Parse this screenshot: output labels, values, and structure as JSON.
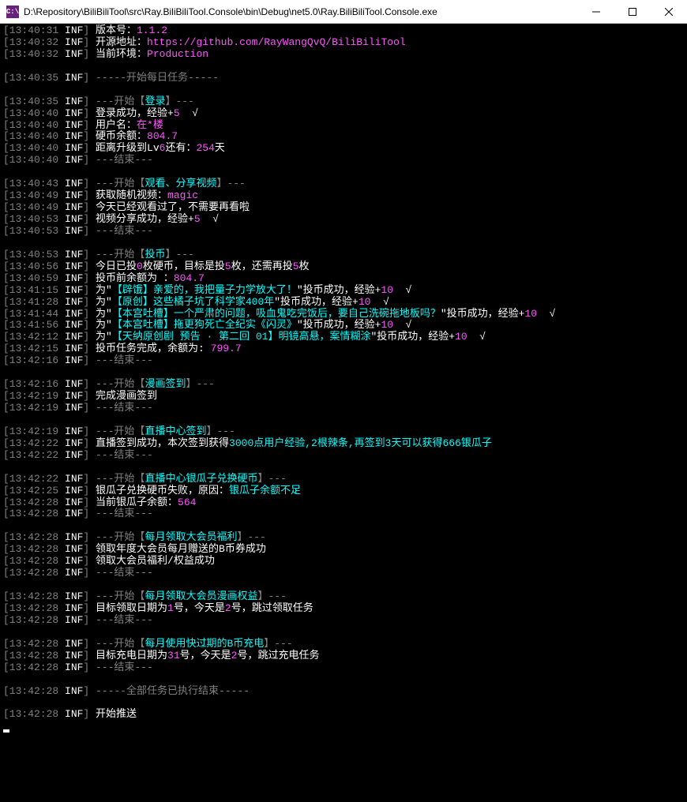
{
  "window": {
    "title": "D:\\Repository\\BiliBiliTool\\src\\Ray.BiliBiliTool.Console\\bin\\Debug\\net5.0\\Ray.BiliBiliTool.Console.exe",
    "icon_label": "C:\\"
  },
  "lines": [
    {
      "ts": "13:40:31",
      "seg": [
        [
          "white",
          "版本号："
        ],
        [
          "magenta",
          "1.1.2"
        ]
      ]
    },
    {
      "ts": "13:40:32",
      "seg": [
        [
          "white",
          "开源地址："
        ],
        [
          "magenta",
          "https://github.com/RayWangQvQ/BiliBiliTool"
        ]
      ]
    },
    {
      "ts": "13:40:32",
      "seg": [
        [
          "white",
          "当前环境："
        ],
        [
          "magenta",
          "Production"
        ]
      ]
    },
    {
      "blank": true
    },
    {
      "ts": "13:40:35",
      "seg": [
        [
          "gray",
          "-----开始每日任务-----"
        ]
      ]
    },
    {
      "blank": true
    },
    {
      "ts": "13:40:35",
      "seg": [
        [
          "gray",
          "---开始【"
        ],
        [
          "cyan",
          "登录"
        ],
        [
          "gray",
          "】---"
        ]
      ]
    },
    {
      "ts": "13:40:40",
      "seg": [
        [
          "white",
          "登录成功，经验+"
        ],
        [
          "magenta",
          "5"
        ],
        [
          "white",
          "  √"
        ]
      ]
    },
    {
      "ts": "13:40:40",
      "seg": [
        [
          "white",
          "用户名："
        ],
        [
          "magenta",
          "在*楼"
        ]
      ]
    },
    {
      "ts": "13:40:40",
      "seg": [
        [
          "white",
          "硬币余额："
        ],
        [
          "magenta",
          "804.7"
        ]
      ]
    },
    {
      "ts": "13:40:40",
      "seg": [
        [
          "white",
          "距离升级到Lv"
        ],
        [
          "magenta",
          "6"
        ],
        [
          "white",
          "还有："
        ],
        [
          "magenta",
          "254"
        ],
        [
          "white",
          "天"
        ]
      ]
    },
    {
      "ts": "13:40:40",
      "seg": [
        [
          "gray",
          "---结束---"
        ]
      ]
    },
    {
      "blank": true
    },
    {
      "ts": "13:40:43",
      "seg": [
        [
          "gray",
          "---开始【"
        ],
        [
          "cyan",
          "观看、分享视频"
        ],
        [
          "gray",
          "】---"
        ]
      ]
    },
    {
      "ts": "13:40:49",
      "seg": [
        [
          "white",
          "获取随机视频："
        ],
        [
          "magenta",
          "magic"
        ]
      ]
    },
    {
      "ts": "13:40:49",
      "seg": [
        [
          "white",
          "今天已经观看过了，不需要再看啦"
        ]
      ]
    },
    {
      "ts": "13:40:53",
      "seg": [
        [
          "white",
          "视频分享成功，经验+"
        ],
        [
          "magenta",
          "5"
        ],
        [
          "white",
          "  √"
        ]
      ]
    },
    {
      "ts": "13:40:53",
      "seg": [
        [
          "gray",
          "---结束---"
        ]
      ]
    },
    {
      "blank": true
    },
    {
      "ts": "13:40:53",
      "seg": [
        [
          "gray",
          "---开始【"
        ],
        [
          "cyan",
          "投币"
        ],
        [
          "gray",
          "】---"
        ]
      ]
    },
    {
      "ts": "13:40:56",
      "seg": [
        [
          "white",
          "今日已投"
        ],
        [
          "magenta",
          "0"
        ],
        [
          "white",
          "枚硬币，目标是投"
        ],
        [
          "magenta",
          "5"
        ],
        [
          "white",
          "枚，还需再投"
        ],
        [
          "magenta",
          "5"
        ],
        [
          "white",
          "枚"
        ]
      ]
    },
    {
      "ts": "13:40:59",
      "seg": [
        [
          "white",
          "投币前余额为 ："
        ],
        [
          "magenta",
          "804.7"
        ]
      ]
    },
    {
      "ts": "13:41:15",
      "seg": [
        [
          "white",
          "为\""
        ],
        [
          "cyan",
          "【辟饿】亲爱的，我把量子力学放大了！"
        ],
        [
          "white",
          "\"投币成功，经验+"
        ],
        [
          "magenta",
          "10"
        ],
        [
          "white",
          "  √"
        ]
      ]
    },
    {
      "ts": "13:41:28",
      "seg": [
        [
          "white",
          "为\""
        ],
        [
          "cyan",
          "【原创】这些橘子坑了科学家400年"
        ],
        [
          "white",
          "\"投币成功，经验+"
        ],
        [
          "magenta",
          "10"
        ],
        [
          "white",
          "  √"
        ]
      ]
    },
    {
      "ts": "13:41:44",
      "seg": [
        [
          "white",
          "为\""
        ],
        [
          "cyan",
          "【本宫吐槽】一个严肃的问题，吸血鬼吃完饭后，要自己洗碗拖地板吗？"
        ],
        [
          "white",
          "\"投币成功，经验+"
        ],
        [
          "magenta",
          "10"
        ],
        [
          "white",
          "  √"
        ]
      ]
    },
    {
      "ts": "13:41:56",
      "seg": [
        [
          "white",
          "为\""
        ],
        [
          "cyan",
          "【本宫吐槽】拖更狗死亡全纪实《闪灵》"
        ],
        [
          "white",
          "\"投币成功，经验+"
        ],
        [
          "magenta",
          "10"
        ],
        [
          "white",
          "  √"
        ]
      ]
    },
    {
      "ts": "13:42:12",
      "seg": [
        [
          "white",
          "为\""
        ],
        [
          "cyan",
          "【天纳原创剧 预告 · 第二回 01】明镜高悬，案情糊涂"
        ],
        [
          "white",
          "\"投币成功，经验+"
        ],
        [
          "magenta",
          "10"
        ],
        [
          "white",
          "  √"
        ]
      ]
    },
    {
      "ts": "13:42:15",
      "seg": [
        [
          "white",
          "投币任务完成，余额为: "
        ],
        [
          "magenta",
          "799.7"
        ]
      ]
    },
    {
      "ts": "13:42:16",
      "seg": [
        [
          "gray",
          "---结束---"
        ]
      ]
    },
    {
      "blank": true
    },
    {
      "ts": "13:42:16",
      "seg": [
        [
          "gray",
          "---开始【"
        ],
        [
          "cyan",
          "漫画签到"
        ],
        [
          "gray",
          "】---"
        ]
      ]
    },
    {
      "ts": "13:42:19",
      "seg": [
        [
          "white",
          "完成漫画签到"
        ]
      ]
    },
    {
      "ts": "13:42:19",
      "seg": [
        [
          "gray",
          "---结束---"
        ]
      ]
    },
    {
      "blank": true
    },
    {
      "ts": "13:42:19",
      "seg": [
        [
          "gray",
          "---开始【"
        ],
        [
          "cyan",
          "直播中心签到"
        ],
        [
          "gray",
          "】---"
        ]
      ]
    },
    {
      "ts": "13:42:22",
      "seg": [
        [
          "white",
          "直播签到成功，本次签到获得"
        ],
        [
          "cyan",
          "3000点用户经验,2根辣条,再签到3天可以获得666银瓜子"
        ]
      ]
    },
    {
      "ts": "13:42:22",
      "seg": [
        [
          "gray",
          "---结束---"
        ]
      ]
    },
    {
      "blank": true
    },
    {
      "ts": "13:42:22",
      "seg": [
        [
          "gray",
          "---开始【"
        ],
        [
          "cyan",
          "直播中心银瓜子兑换硬币"
        ],
        [
          "gray",
          "】---"
        ]
      ]
    },
    {
      "ts": "13:42:25",
      "seg": [
        [
          "white",
          "银瓜子兑换硬币失败，原因："
        ],
        [
          "cyan",
          "银瓜子余额不足"
        ]
      ]
    },
    {
      "ts": "13:42:28",
      "seg": [
        [
          "white",
          "当前银瓜子余额："
        ],
        [
          "magenta",
          "564"
        ]
      ]
    },
    {
      "ts": "13:42:28",
      "seg": [
        [
          "gray",
          "---结束---"
        ]
      ]
    },
    {
      "blank": true
    },
    {
      "ts": "13:42:28",
      "seg": [
        [
          "gray",
          "---开始【"
        ],
        [
          "cyan",
          "每月领取大会员福利"
        ],
        [
          "gray",
          "】---"
        ]
      ]
    },
    {
      "ts": "13:42:28",
      "seg": [
        [
          "white",
          "领取年度大会员每月赠送的B币券成功"
        ]
      ]
    },
    {
      "ts": "13:42:28",
      "seg": [
        [
          "white",
          "领取大会员福利/权益成功"
        ]
      ]
    },
    {
      "ts": "13:42:28",
      "seg": [
        [
          "gray",
          "---结束---"
        ]
      ]
    },
    {
      "blank": true
    },
    {
      "ts": "13:42:28",
      "seg": [
        [
          "gray",
          "---开始【"
        ],
        [
          "cyan",
          "每月领取大会员漫画权益"
        ],
        [
          "gray",
          "】---"
        ]
      ]
    },
    {
      "ts": "13:42:28",
      "seg": [
        [
          "white",
          "目标领取日期为"
        ],
        [
          "magenta",
          "1"
        ],
        [
          "white",
          "号，今天是"
        ],
        [
          "magenta",
          "2"
        ],
        [
          "white",
          "号，跳过领取任务"
        ]
      ]
    },
    {
      "ts": "13:42:28",
      "seg": [
        [
          "gray",
          "---结束---"
        ]
      ]
    },
    {
      "blank": true
    },
    {
      "ts": "13:42:28",
      "seg": [
        [
          "gray",
          "---开始【"
        ],
        [
          "cyan",
          "每月使用快过期的B币充电"
        ],
        [
          "gray",
          "】---"
        ]
      ]
    },
    {
      "ts": "13:42:28",
      "seg": [
        [
          "white",
          "目标充电日期为"
        ],
        [
          "magenta",
          "31"
        ],
        [
          "white",
          "号，今天是"
        ],
        [
          "magenta",
          "2"
        ],
        [
          "white",
          "号，跳过充电任务"
        ]
      ]
    },
    {
      "ts": "13:42:28",
      "seg": [
        [
          "gray",
          "---结束---"
        ]
      ]
    },
    {
      "blank": true
    },
    {
      "ts": "13:42:28",
      "seg": [
        [
          "gray",
          "-----全部任务已执行结束-----"
        ]
      ]
    },
    {
      "blank": true
    },
    {
      "ts": "13:42:28",
      "seg": [
        [
          "white",
          "开始推送"
        ]
      ]
    }
  ],
  "level": "INF"
}
